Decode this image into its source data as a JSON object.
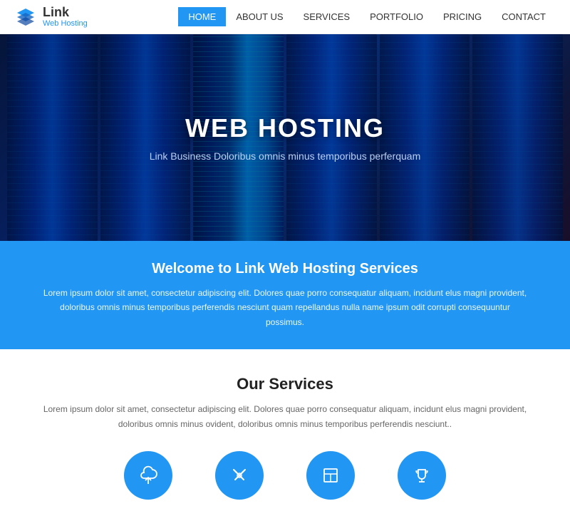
{
  "header": {
    "logo_link": "Link",
    "logo_sub": "Web Hosting",
    "nav": [
      {
        "label": "HOME",
        "active": true
      },
      {
        "label": "ABOUT US",
        "active": false
      },
      {
        "label": "SERVICES",
        "active": false
      },
      {
        "label": "PORTFOLIO",
        "active": false
      },
      {
        "label": "PRICING",
        "active": false
      },
      {
        "label": "CONTACT",
        "active": false
      }
    ]
  },
  "hero": {
    "title": "WEB HOSTING",
    "subtitle": "Link Business Doloribus omnis minus temporibus perferquam"
  },
  "welcome": {
    "title": "Welcome to Link Web Hosting Services",
    "text": "Lorem ipsum dolor sit amet, consectetur adipiscing elit. Dolores quae porro consequatur aliquam, incidunt elus magni provident, doloribus omnis minus temporibus perferendis nesciunt quam repellandus nulla name ipsum odit corrupti consequuntur possimus."
  },
  "services": {
    "title": "Our Services",
    "text": "Lorem ipsum dolor sit amet, consectetur adipiscing elit. Dolores quae porro consequatur aliquam, incidunt elus magni provident, doloribus omnis minus ovident, doloribus omnis minus temporibus perferendis nesciunt..",
    "icons": [
      {
        "name": "cloud-upload",
        "label": "Cloud"
      },
      {
        "name": "tools",
        "label": "Tools"
      },
      {
        "name": "layout",
        "label": "Layout"
      },
      {
        "name": "trophy",
        "label": "Trophy"
      }
    ]
  }
}
